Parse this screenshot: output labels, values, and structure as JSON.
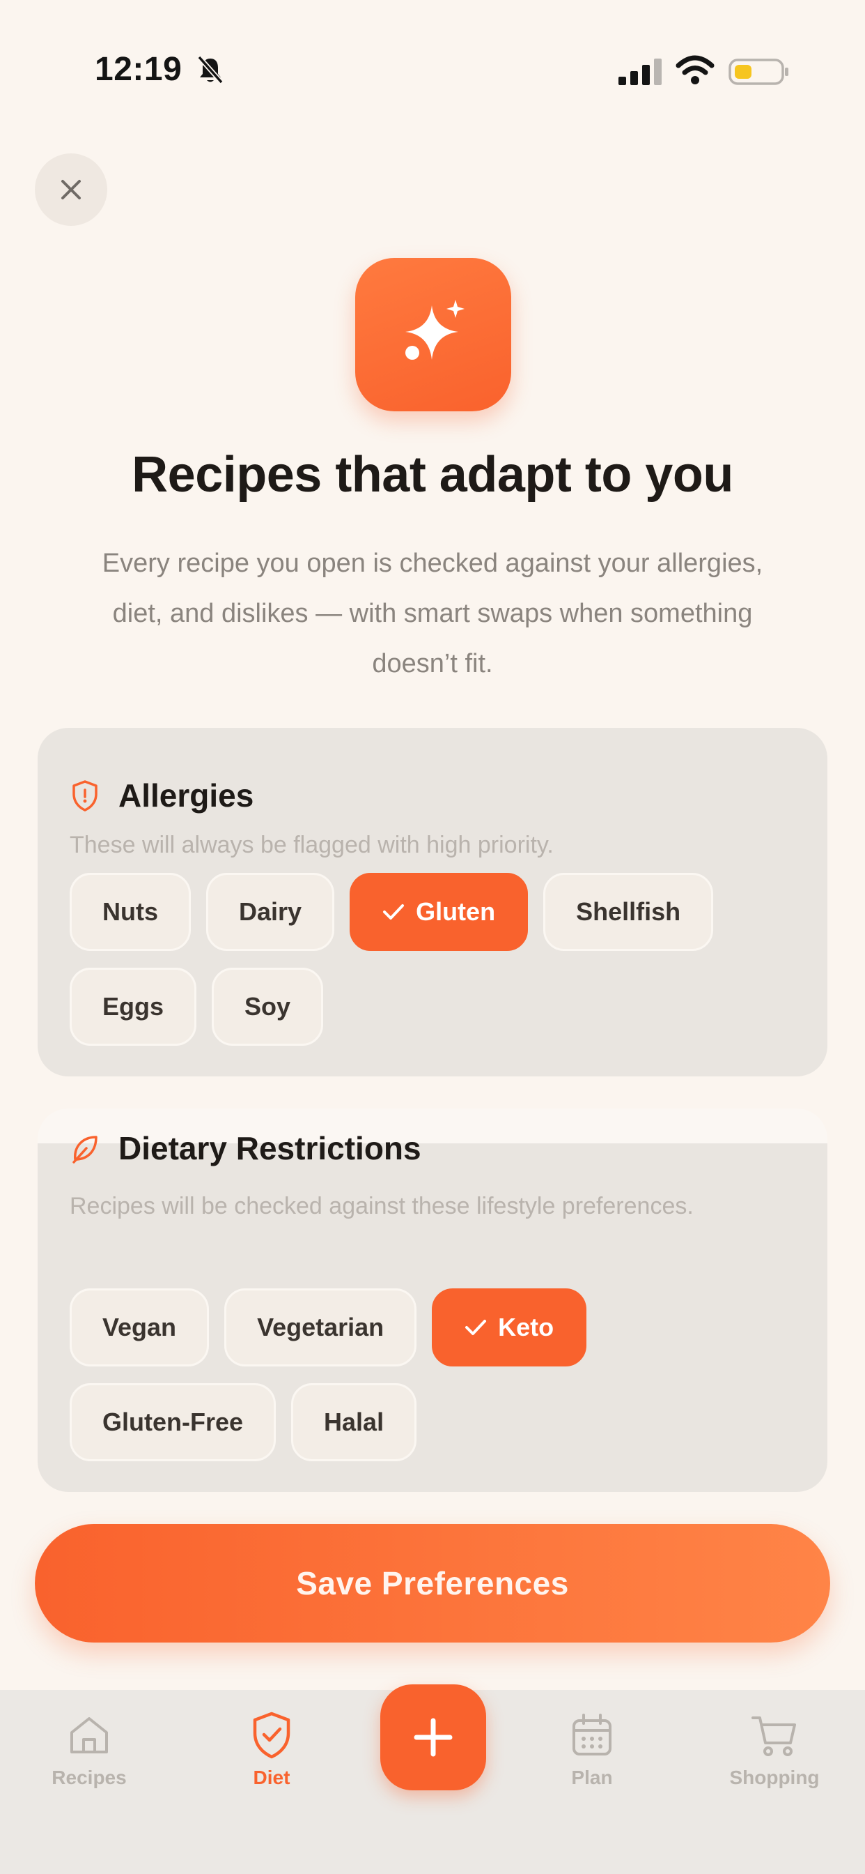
{
  "status_bar": {
    "time": "12:19"
  },
  "hero": {
    "title": "Recipes that adapt to you",
    "subtitle": "Every recipe you open is checked against your allergies, diet, and dislikes — with smart swaps when something doesn’t fit."
  },
  "allergies": {
    "title": "Allergies",
    "description": "These will always be flagged with high priority.",
    "options": [
      {
        "label": "Nuts",
        "selected": false
      },
      {
        "label": "Dairy",
        "selected": false
      },
      {
        "label": "Gluten",
        "selected": true
      },
      {
        "label": "Shellfish",
        "selected": false
      },
      {
        "label": "Eggs",
        "selected": false
      },
      {
        "label": "Soy",
        "selected": false
      }
    ]
  },
  "diet": {
    "title": "Dietary Restrictions",
    "description": "Recipes will be checked against these lifestyle preferences.",
    "options": [
      {
        "label": "Vegan",
        "selected": false
      },
      {
        "label": "Vegetarian",
        "selected": false
      },
      {
        "label": "Keto",
        "selected": true
      },
      {
        "label": "Gluten-Free",
        "selected": false
      },
      {
        "label": "Halal",
        "selected": false
      }
    ]
  },
  "save_button": {
    "label": "Save Preferences"
  },
  "tab_bar": {
    "tabs": [
      {
        "label": "Recipes",
        "icon": "home-icon",
        "active": false
      },
      {
        "label": "Diet",
        "icon": "shield-check-icon",
        "active": true
      },
      {
        "label": "Plan",
        "icon": "calendar-icon",
        "active": false
      },
      {
        "label": "Shopping",
        "icon": "cart-icon",
        "active": false
      }
    ],
    "center_action_icon": "plus-icon"
  },
  "colors": {
    "accent": "#f9622d",
    "background": "#fbf5ef",
    "card": "#e9e5e0",
    "chip": "#f3ede6",
    "muted_text": "#8a847e"
  }
}
